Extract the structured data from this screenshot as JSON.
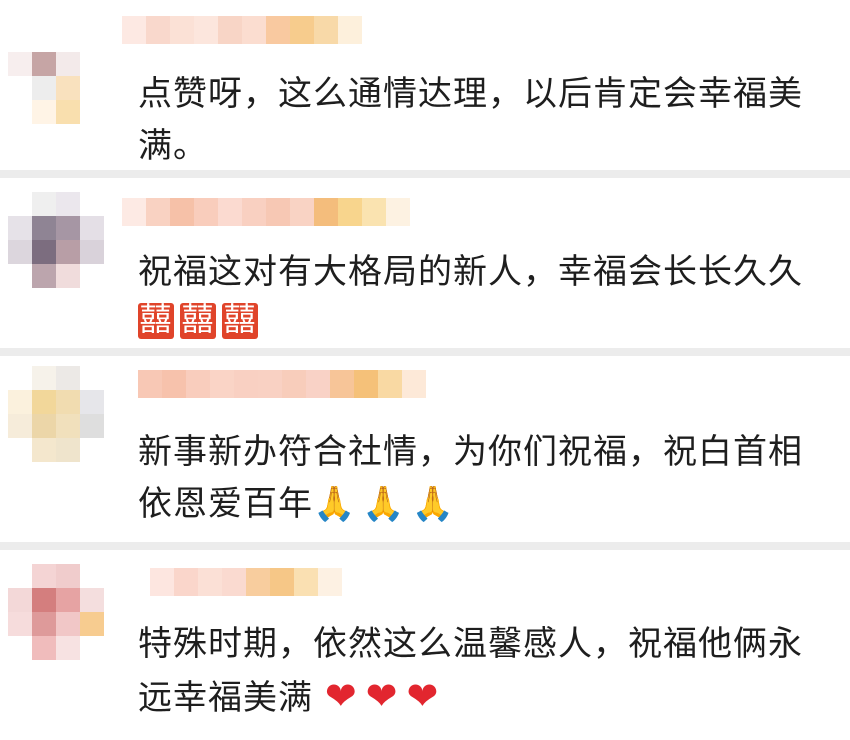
{
  "comments": [
    {
      "lines": [
        "点赞呀，这么通情达理，以后肯定会幸福美",
        "满。"
      ],
      "emojis": []
    },
    {
      "lines": [
        "祝福这对有大格局的新人，幸福会长长久久",
        ""
      ],
      "emojis": [
        "囍",
        "囍",
        "囍"
      ]
    },
    {
      "lines": [
        "新事新办符合社情，为你们祝福，祝白首相",
        "依恩爱百年"
      ],
      "emojis": [
        "🙏",
        "🙏",
        "🙏"
      ]
    },
    {
      "lines": [
        "特殊时期，依然这么温馨感人，祝福他俩永",
        "远幸福美满"
      ],
      "emojis": [
        "❤",
        "❤",
        "❤"
      ]
    }
  ]
}
